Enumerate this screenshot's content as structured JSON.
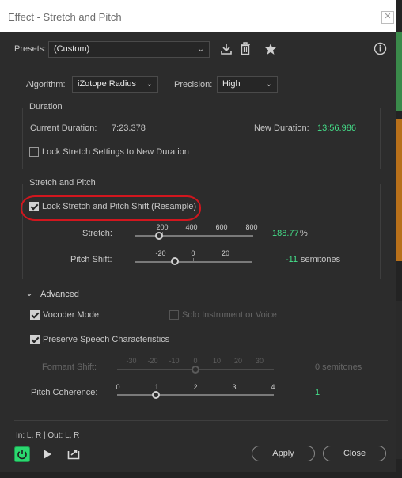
{
  "window": {
    "title": "Effect - Stretch and Pitch",
    "close_glyph": "✕"
  },
  "presets": {
    "label": "Presets:",
    "value": "(Custom)",
    "icons": [
      "download-icon",
      "trash-icon",
      "star-icon",
      "info-icon"
    ]
  },
  "algorithm": {
    "label": "Algorithm:",
    "value": "iZotope Radius"
  },
  "precision": {
    "label": "Precision:",
    "value": "High"
  },
  "duration": {
    "group_title": "Duration",
    "current_label": "Current Duration:",
    "current_value": "7:23.378",
    "new_label": "New Duration:",
    "new_value": "13:56.986",
    "lock_label": "Lock Stretch Settings to New Duration",
    "lock_checked": false
  },
  "stretch_pitch": {
    "group_title": "Stretch and Pitch",
    "lock_label": "Lock Stretch and Pitch Shift (Resample)",
    "lock_checked": true,
    "stretch": {
      "label": "Stretch:",
      "ticks": [
        "200",
        "400",
        "600",
        "800"
      ],
      "value": "188.77",
      "unit": "%",
      "numeric": 188.77,
      "min": 0,
      "max": 800
    },
    "pitch": {
      "label": "Pitch Shift:",
      "ticks": [
        "-20",
        "0",
        "20"
      ],
      "value": "-11",
      "unit": "semitones",
      "numeric": -11,
      "min": -36,
      "max": 36
    }
  },
  "advanced": {
    "title": "Advanced",
    "vocoder_label": "Vocoder Mode",
    "vocoder_checked": true,
    "solo_label": "Solo Instrument or Voice",
    "solo_checked": false,
    "preserve_label": "Preserve Speech Characteristics",
    "preserve_checked": true,
    "formant": {
      "label": "Formant Shift:",
      "ticks": [
        "-30",
        "-20",
        "-10",
        "0",
        "10",
        "20",
        "30"
      ],
      "value": "0 semitones",
      "numeric": 0
    },
    "coherence": {
      "label": "Pitch Coherence:",
      "ticks": [
        "0",
        "1",
        "2",
        "3",
        "4"
      ],
      "value": "1",
      "numeric": 1
    }
  },
  "footer": {
    "io_text": "In: L, R | Out: L, R",
    "apply_label": "Apply",
    "close_label": "Close"
  },
  "colors": {
    "accent_green": "#45e08a",
    "annotation_red": "#d2161e",
    "power_green": "#2bd86f"
  }
}
